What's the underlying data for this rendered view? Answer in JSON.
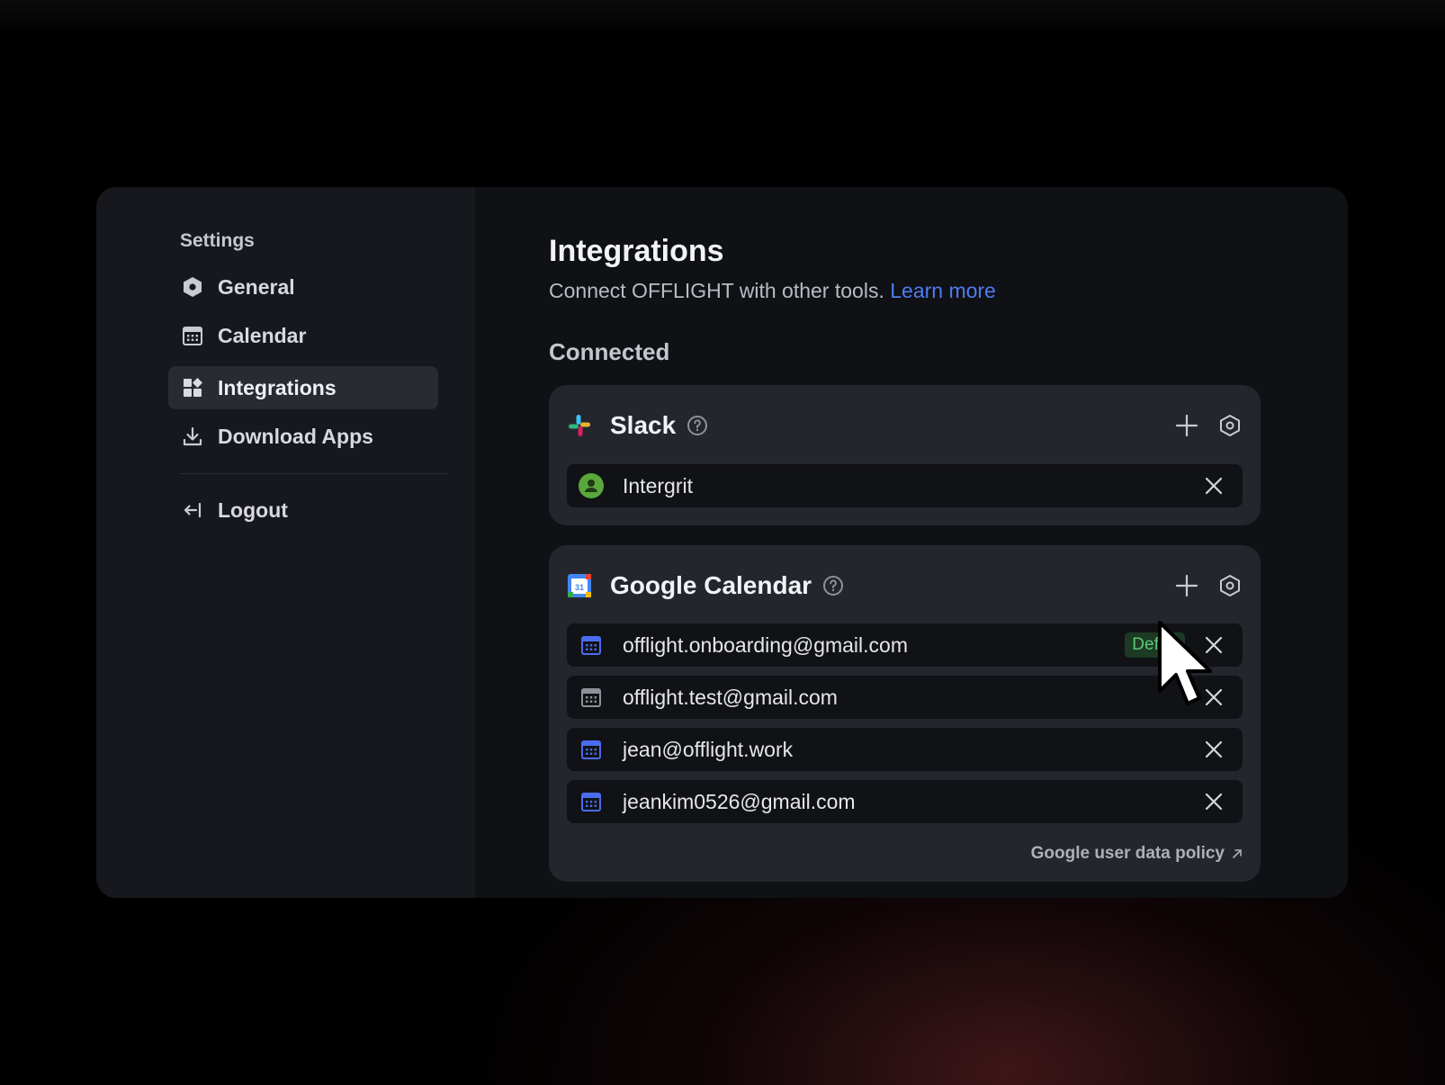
{
  "sidebar": {
    "heading": "Settings",
    "items": [
      {
        "label": "General",
        "icon": "hexagon-icon"
      },
      {
        "label": "Calendar",
        "icon": "calendar-icon"
      },
      {
        "label": "Integrations",
        "icon": "integrations-icon",
        "active": true
      },
      {
        "label": "Download Apps",
        "icon": "download-icon"
      }
    ],
    "logout_label": "Logout"
  },
  "main": {
    "title": "Integrations",
    "subtitle": "Connect OFFLIGHT with other tools.",
    "learn_more": "Learn more",
    "section_label": "Connected"
  },
  "slack": {
    "title": "Slack",
    "accounts": [
      {
        "label": "Intergrit",
        "icon": "user-avatar-icon"
      }
    ]
  },
  "google_calendar": {
    "title": "Google Calendar",
    "accounts": [
      {
        "label": "offlight.onboarding@gmail.com",
        "badge": "Defau",
        "icon_color": "#4b6cf0"
      },
      {
        "label": "offlight.test@gmail.com",
        "icon_color": "#8f919a"
      },
      {
        "label": "jean@offlight.work",
        "icon_color": "#4b6cf0"
      },
      {
        "label": "jeankim0526@gmail.com",
        "icon_color": "#4b6cf0"
      }
    ],
    "policy_link": "Google user data policy"
  },
  "colors": {
    "accent_link": "#4f7cf0",
    "badge_text": "#5bc872",
    "badge_bg": "#1c3a24",
    "avatar_green": "#5aa83c"
  }
}
